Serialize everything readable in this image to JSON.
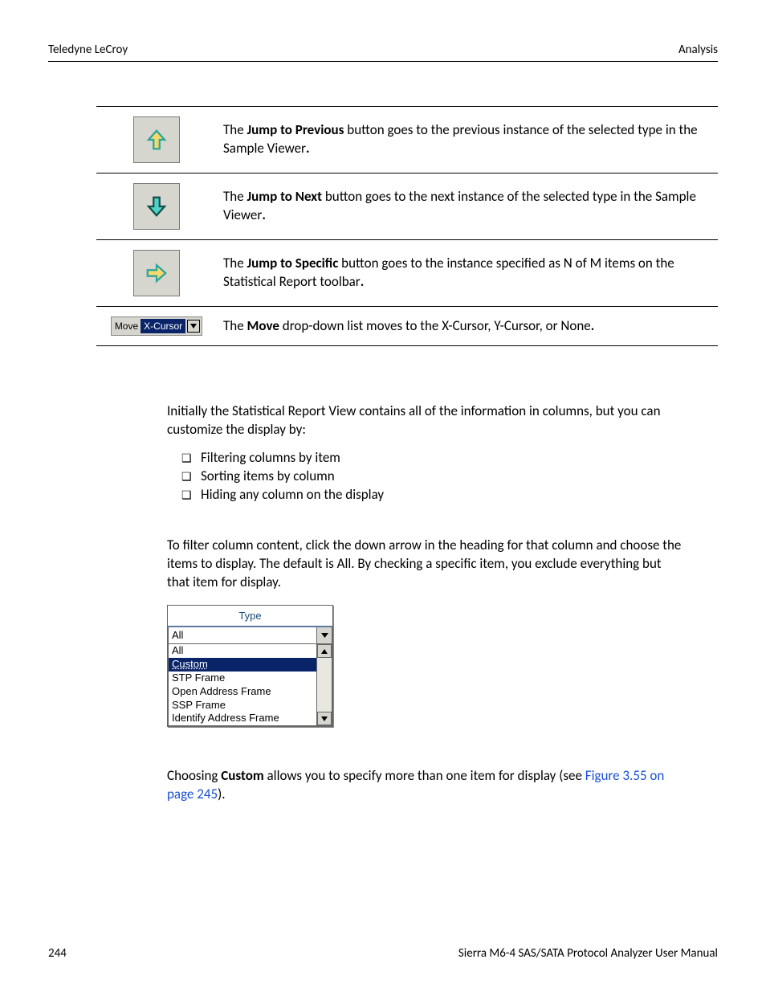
{
  "header": {
    "left": "Teledyne LeCroy",
    "right": "Analysis"
  },
  "table": {
    "rows": [
      {
        "bold": "Jump to Previous",
        "pre": "The ",
        "post": " button goes to the previous instance of the selected type in the Sample Viewer",
        "dot": "."
      },
      {
        "bold": "Jump to Next",
        "pre": "The ",
        "post": " button goes to the next instance of the selected type in the Sample Viewer",
        "dot": "."
      },
      {
        "bold": "Jump to Specific",
        "pre": "The ",
        "post": " button goes to the instance specified as N of M items on the Statistical Report toolbar",
        "dot": "."
      },
      {
        "bold": "Move",
        "pre": "The ",
        "post": " drop-down list moves to the X-Cursor, Y-Cursor, or None",
        "dot": "."
      }
    ],
    "move_widget": {
      "label": "Move",
      "value": "X-Cursor"
    }
  },
  "intro": "Initially the Statistical Report View contains all of the information in columns, but you can customize the display by:",
  "bullets": [
    "Filtering columns by item",
    "Sorting items by column",
    "Hiding any column on the display"
  ],
  "filter_para": "To filter column content, click the down arrow in the heading for that column and choose the items to display. The default is All. By checking a specific item, you exclude everything but that item for display.",
  "dropdown": {
    "header": "Type",
    "selected": "All",
    "items": [
      "All",
      "Custom",
      "STP Frame",
      "Open Address Frame",
      "SSP Frame",
      "Identify Address Frame"
    ],
    "highlighted_index": 1
  },
  "custom_para": {
    "pre": "Choosing ",
    "bold": "Custom",
    "mid": " allows you to specify more than one item for display (see ",
    "link": "Figure 3.55 on page 245",
    "post": ")."
  },
  "footer": {
    "left": "244",
    "right": "Sierra M6-4 SAS/SATA Protocol Analyzer User Manual"
  }
}
